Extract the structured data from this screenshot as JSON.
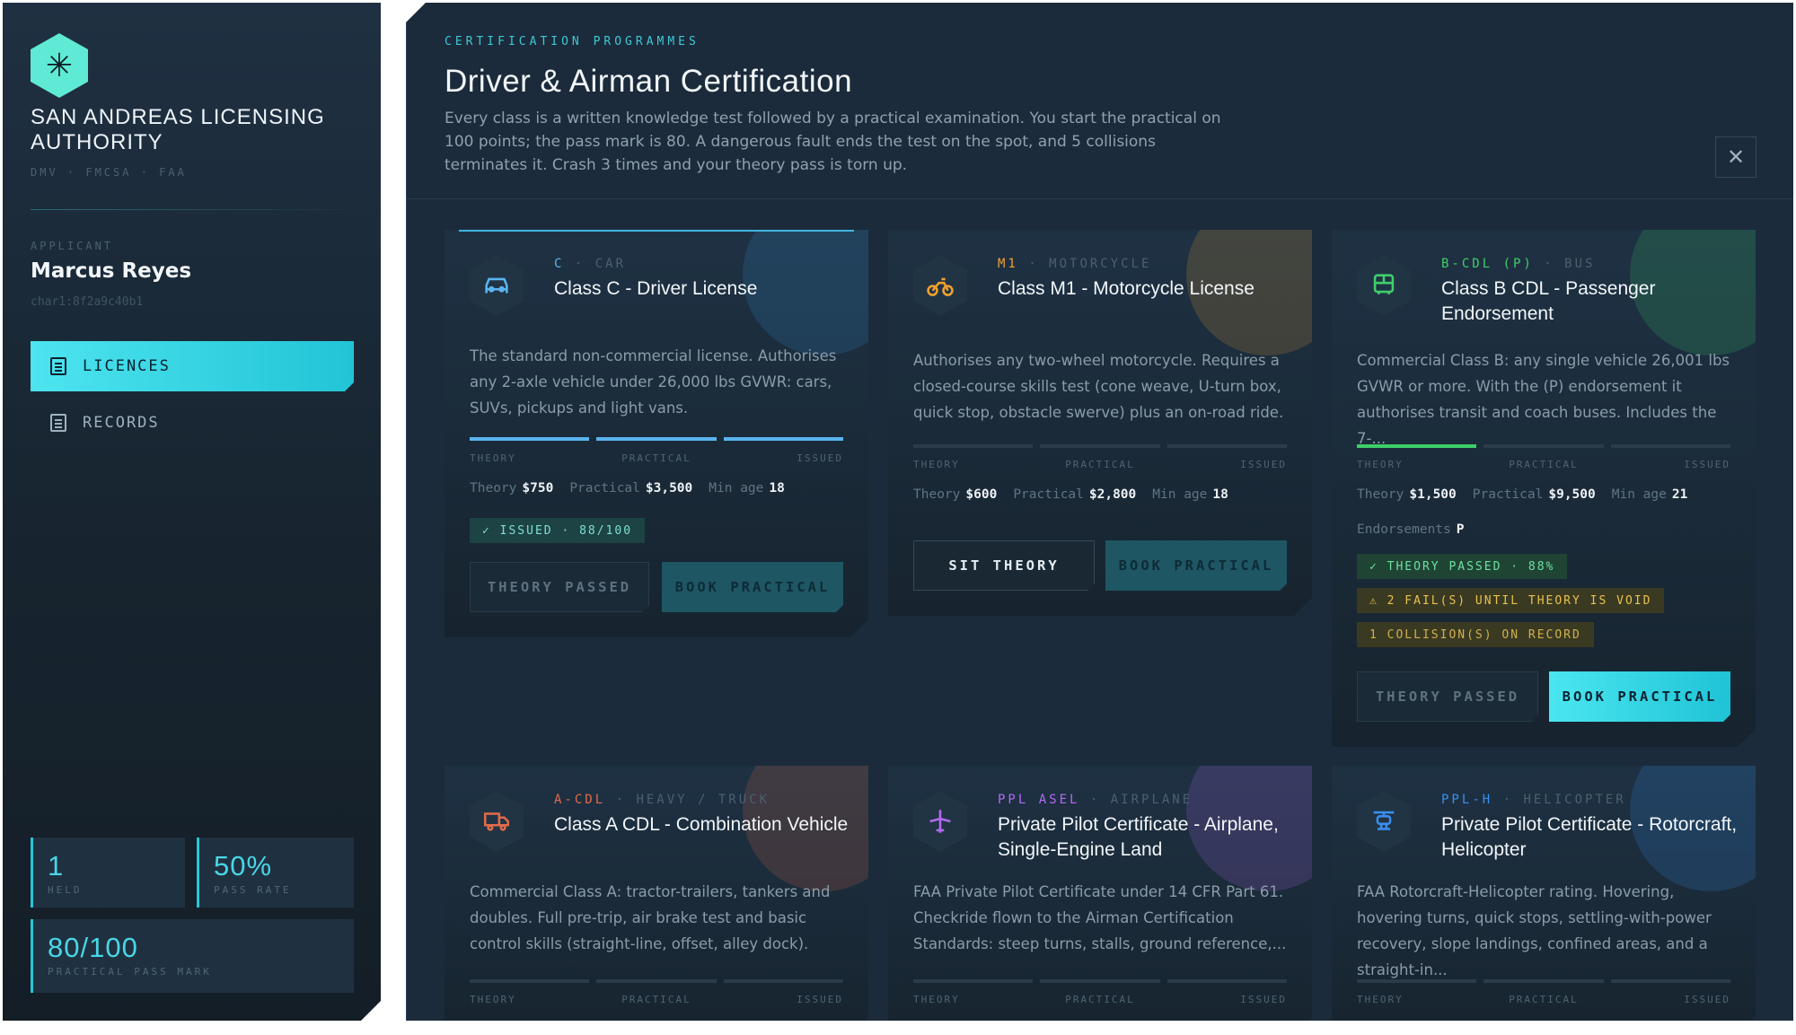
{
  "sidebar": {
    "logo_glyph": "✳",
    "org_name": "San Andreas Licensing Authority",
    "org_sub": "DMV · FMCSA · FAA",
    "applicant_label": "APPLICANT",
    "applicant_name": "Marcus Reyes",
    "applicant_id": "char1:8f2a9c40b1",
    "nav": [
      {
        "label": "LICENCES",
        "icon": "document-icon",
        "active": true
      },
      {
        "label": "RECORDS",
        "icon": "document-icon",
        "active": false
      }
    ],
    "stats": {
      "held_value": "1",
      "held_label": "HELD",
      "rate_value": "50%",
      "rate_label": "PASS RATE",
      "mark_value": "80/100",
      "mark_label": "PRACTICAL PASS MARK"
    }
  },
  "header": {
    "eyebrow": "CERTIFICATION PROGRAMMES",
    "title": "Driver & Airman Certification",
    "description": "Every class is a written knowledge test followed by a practical examination. You start the practical on 100 points; the pass mark is 80. A dangerous fault ends the test on the spot, and 5 collisions terminates it. Crash 3 times and your theory pass is torn up.",
    "close_glyph": "✕"
  },
  "stage_labels": [
    "THEORY",
    "PRACTICAL",
    "ISSUED"
  ],
  "fee_labels": {
    "theory": "Theory",
    "practical": "Practical",
    "min_age": "Min age",
    "endorsements": "Endorsements"
  },
  "colors": {
    "accent": "#3fc8d4",
    "car": "#5ab4f0",
    "moto": "#f0a030",
    "bus": "#3ecf6a",
    "truck": "#e06a4a",
    "airplane": "#b36af0",
    "helicopter": "#3a8ef0"
  },
  "cards": [
    {
      "code": "C",
      "category": "CAR",
      "name": "Class C - Driver License",
      "icon": "car-icon",
      "description": "The standard non-commercial license. Authorises any 2-axle vehicle under 26,000 lbs GVWR: cars, SUVs, pickups and light vans.",
      "theory_fee": "$750",
      "practical_fee": "$3,500",
      "min_age": "18",
      "badge": "✓ ISSUED · 88/100",
      "buttons": [
        "THEORY PASSED",
        "BOOK PRACTICAL"
      ]
    },
    {
      "code": "M1",
      "category": "MOTORCYCLE",
      "name": "Class M1 - Motorcycle License",
      "icon": "motorcycle-icon",
      "description": "Authorises any two-wheel motorcycle. Requires a closed-course skills test (cone weave, U-turn box, quick stop, obstacle swerve) plus an on-road ride.",
      "theory_fee": "$600",
      "practical_fee": "$2,800",
      "min_age": "18",
      "buttons": [
        "SIT THEORY",
        "BOOK PRACTICAL"
      ]
    },
    {
      "code": "B-CDL (P)",
      "category": "BUS",
      "name": "Class B CDL - Passenger Endorsement",
      "icon": "bus-icon",
      "description": "Commercial Class B: any single vehicle 26,001 lbs GVWR or more. With the (P) endorsement it authorises transit and coach buses. Includes the 7-...",
      "theory_fee": "$1,500",
      "practical_fee": "$9,500",
      "min_age": "21",
      "endorsements": "P",
      "badges": [
        "✓ THEORY PASSED · 88%",
        "⚠ 2 FAIL(S) UNTIL THEORY IS VOID",
        "1 COLLISION(S) ON RECORD"
      ],
      "buttons": [
        "THEORY PASSED",
        "BOOK PRACTICAL"
      ]
    },
    {
      "code": "A-CDL",
      "category": "HEAVY / TRUCK",
      "name": "Class A CDL - Combination Vehicle",
      "icon": "truck-icon",
      "description": "Commercial Class A: tractor-trailers, tankers and doubles. Full pre-trip, air brake test and basic control skills (straight-line, offset, alley dock)."
    },
    {
      "code": "PPL ASEL",
      "category": "AIRPLANE",
      "name": "Private Pilot Certificate - Airplane, Single-Engine Land",
      "icon": "airplane-icon",
      "description": "FAA Private Pilot Certificate under 14 CFR Part 61. Checkride flown to the Airman Certification Standards: steep turns, stalls, ground reference,..."
    },
    {
      "code": "PPL-H",
      "category": "HELICOPTER",
      "name": "Private Pilot Certificate - Rotorcraft, Helicopter",
      "icon": "helicopter-icon",
      "description": "FAA Rotorcraft-Helicopter rating. Hovering, hovering turns, quick stops, settling-with-power recovery, slope landings, confined areas, and a straight-in..."
    }
  ]
}
